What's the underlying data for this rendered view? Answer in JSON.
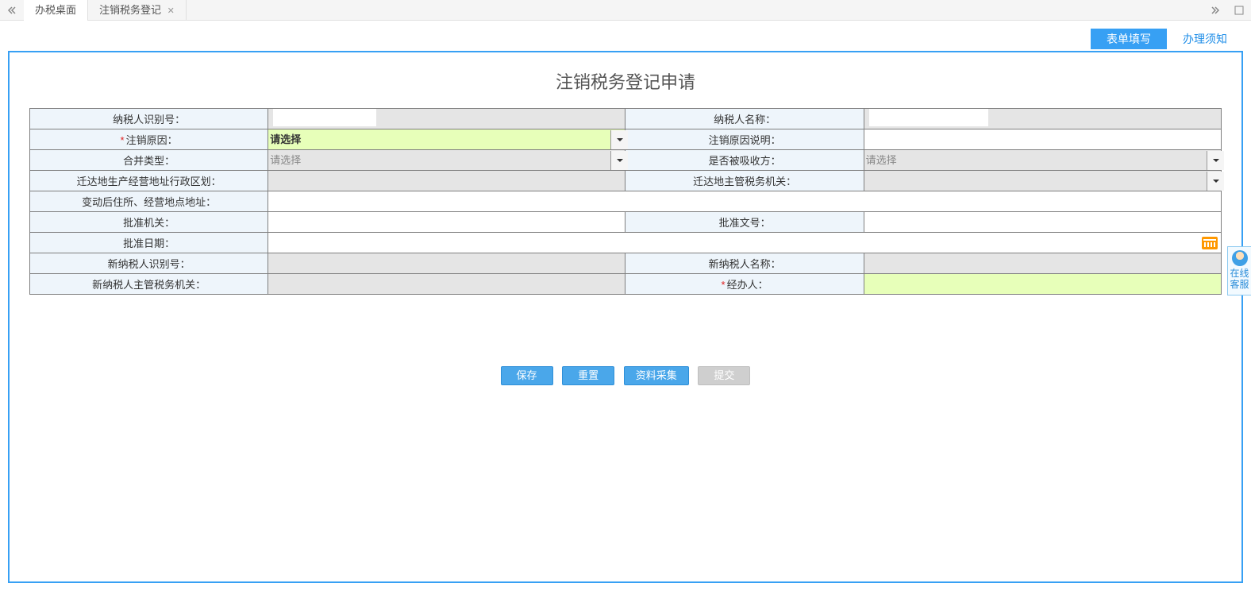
{
  "topbar": {
    "tabs": [
      {
        "label": "办税桌面",
        "closable": false
      },
      {
        "label": "注销税务登记",
        "closable": true
      }
    ]
  },
  "page_tabs": {
    "form_fill": "表单填写",
    "notice": "办理须知"
  },
  "title": "注销税务登记申请",
  "labels": {
    "taxpayer_id": "纳税人识别号：",
    "taxpayer_name": "纳税人名称：",
    "cancel_reason": "注销原因：",
    "cancel_reason_desc": "注销原因说明：",
    "merge_type": "合并类型：",
    "absorbed": "是否被吸收方：",
    "move_admin_division": "迁达地生产经营地址行政区划：",
    "move_tax_authority": "迁达地主管税务机关：",
    "changed_address": "变动后住所、经营地点地址：",
    "approval_org": "批准机关：",
    "approval_no": "批准文号：",
    "approval_date": "批准日期：",
    "new_taxpayer_id": "新纳税人识别号：",
    "new_taxpayer_name": "新纳税人名称：",
    "new_tax_authority": "新纳税人主管税务机关：",
    "operator": "经办人："
  },
  "placeholders": {
    "please_select": "请选择"
  },
  "values": {
    "taxpayer_id": "",
    "taxpayer_name": "",
    "cancel_reason": "请选择",
    "cancel_reason_desc": "",
    "merge_type": "",
    "absorbed": "",
    "move_admin_division": "",
    "move_tax_authority": "",
    "changed_address": "",
    "approval_org": "",
    "approval_no": "",
    "approval_date": "",
    "new_taxpayer_id": "",
    "new_taxpayer_name": "",
    "new_tax_authority": "",
    "operator": ""
  },
  "buttons": {
    "save": "保存",
    "reset": "重置",
    "collect": "资料采集",
    "submit": "提交"
  },
  "help": {
    "label": "在线客服"
  }
}
